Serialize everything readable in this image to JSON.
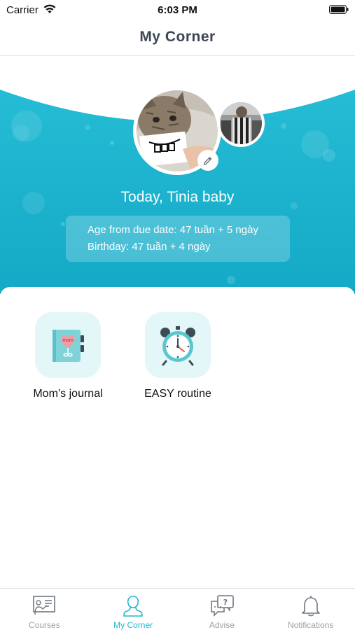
{
  "status_bar": {
    "carrier": "Carrier",
    "time": "6:03 PM"
  },
  "nav": {
    "title": "My Corner"
  },
  "profile": {
    "greeting": "Today, Tinia baby",
    "age_from_due_date": "Age from due date: 47 tuần + 5 ngày",
    "birthday": "Birthday: 47 tuần + 4 ngày"
  },
  "features": [
    {
      "label": "Mom’s journal",
      "icon": "journal-book-icon"
    },
    {
      "label": "EASY routine",
      "icon": "alarm-clock-icon"
    }
  ],
  "tabs": [
    {
      "label": "Courses",
      "icon": "presentation-board-icon",
      "active": false
    },
    {
      "label": "My Corner",
      "icon": "person-icon",
      "active": true
    },
    {
      "label": "Advise",
      "icon": "question-chat-icon",
      "active": false
    },
    {
      "label": "Notifications",
      "icon": "bell-icon",
      "active": false
    }
  ],
  "colors": {
    "accent": "#21b6d0",
    "hero_bg": "#1fb4cf",
    "feature_tile": "#e3f6f8",
    "nav_title": "#3c4654",
    "tab_inactive": "#9aa0a6"
  }
}
